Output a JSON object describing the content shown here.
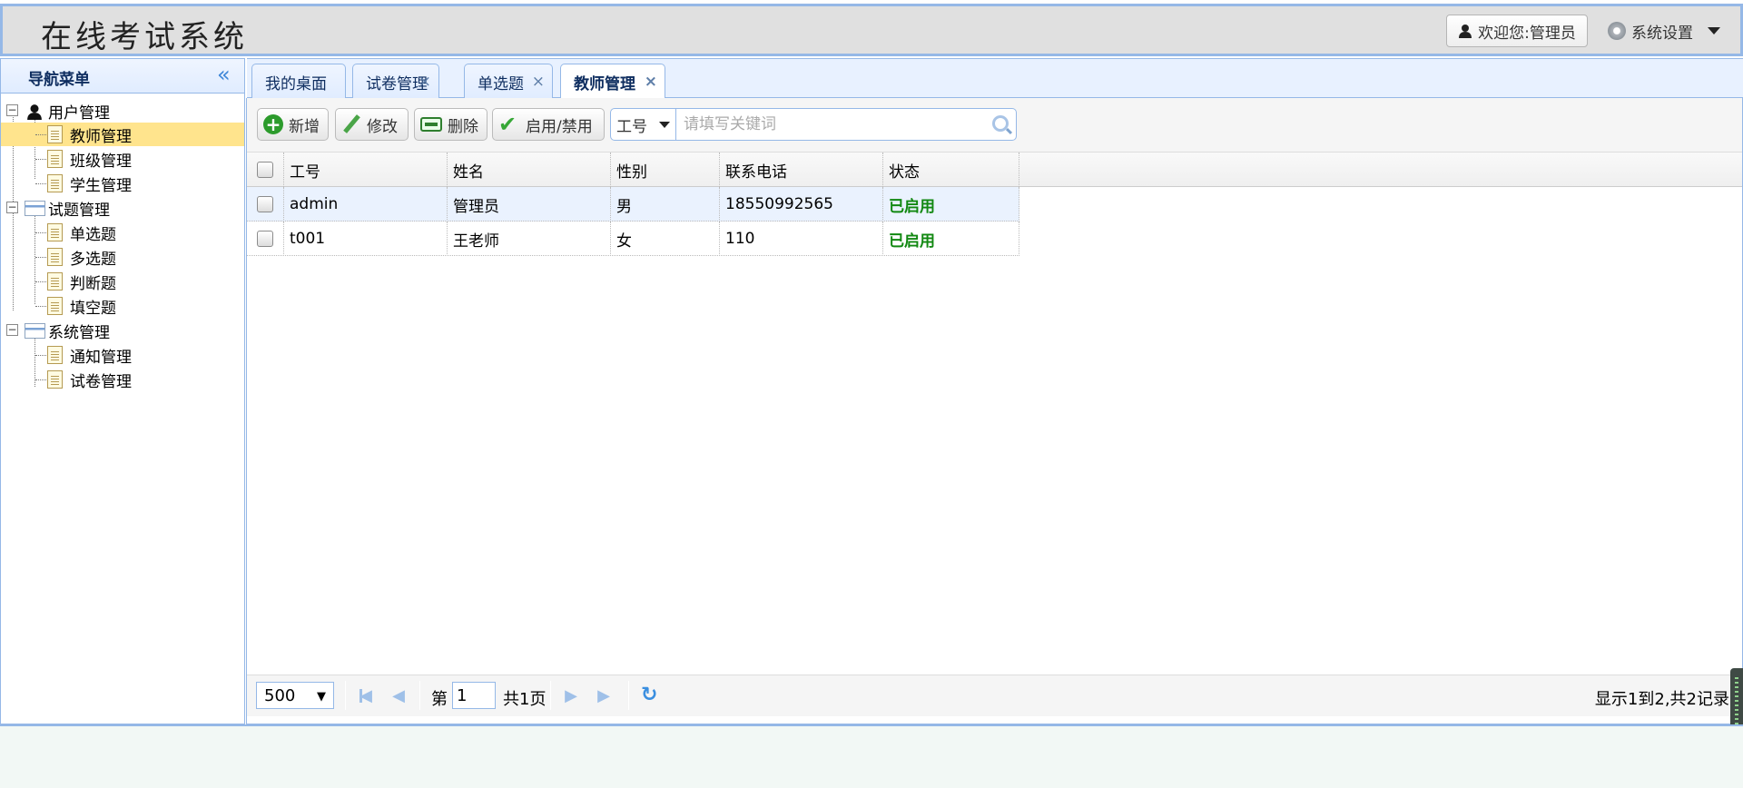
{
  "header": {
    "title": "在线考试系统",
    "welcome_label": "欢迎您:管理员",
    "settings_label": "系统设置"
  },
  "sidebar": {
    "title": "导航菜单",
    "groups": [
      {
        "label": "用户管理",
        "icon": "user-icon",
        "items": [
          {
            "label": "教师管理",
            "selected": true
          },
          {
            "label": "班级管理"
          },
          {
            "label": "学生管理"
          }
        ]
      },
      {
        "label": "试题管理",
        "icon": "folder-icon",
        "items": [
          {
            "label": "单选题"
          },
          {
            "label": "多选题"
          },
          {
            "label": "判断题"
          },
          {
            "label": "填空题"
          }
        ]
      },
      {
        "label": "系统管理",
        "icon": "folder-icon",
        "items": [
          {
            "label": "通知管理"
          },
          {
            "label": "试卷管理"
          }
        ]
      }
    ]
  },
  "tabs": [
    {
      "label": "我的桌面",
      "closable": false
    },
    {
      "label": "试卷管理",
      "closable": true
    },
    {
      "label": "单选题",
      "closable": true
    },
    {
      "label": "教师管理",
      "closable": true,
      "active": true
    }
  ],
  "toolbar": {
    "add_label": "新增",
    "edit_label": "修改",
    "delete_label": "删除",
    "toggle_label": "启用/禁用",
    "search_field": "工号",
    "search_placeholder": "请填写关键词"
  },
  "table": {
    "columns": [
      "工号",
      "姓名",
      "性别",
      "联系电话",
      "状态"
    ],
    "rows": [
      [
        "admin",
        "管理员",
        "男",
        "18550992565",
        "已启用"
      ],
      [
        "t001",
        "王老师",
        "女",
        "110",
        "已启用"
      ]
    ]
  },
  "pager": {
    "page_size": "500",
    "page_prefix": "第",
    "page_value": "1",
    "page_total": "共1页",
    "info": "显示1到2,共2记录"
  },
  "colors": {
    "border": "#95b8e7",
    "selected": "#ffe48d",
    "status_ok": "#118811"
  }
}
